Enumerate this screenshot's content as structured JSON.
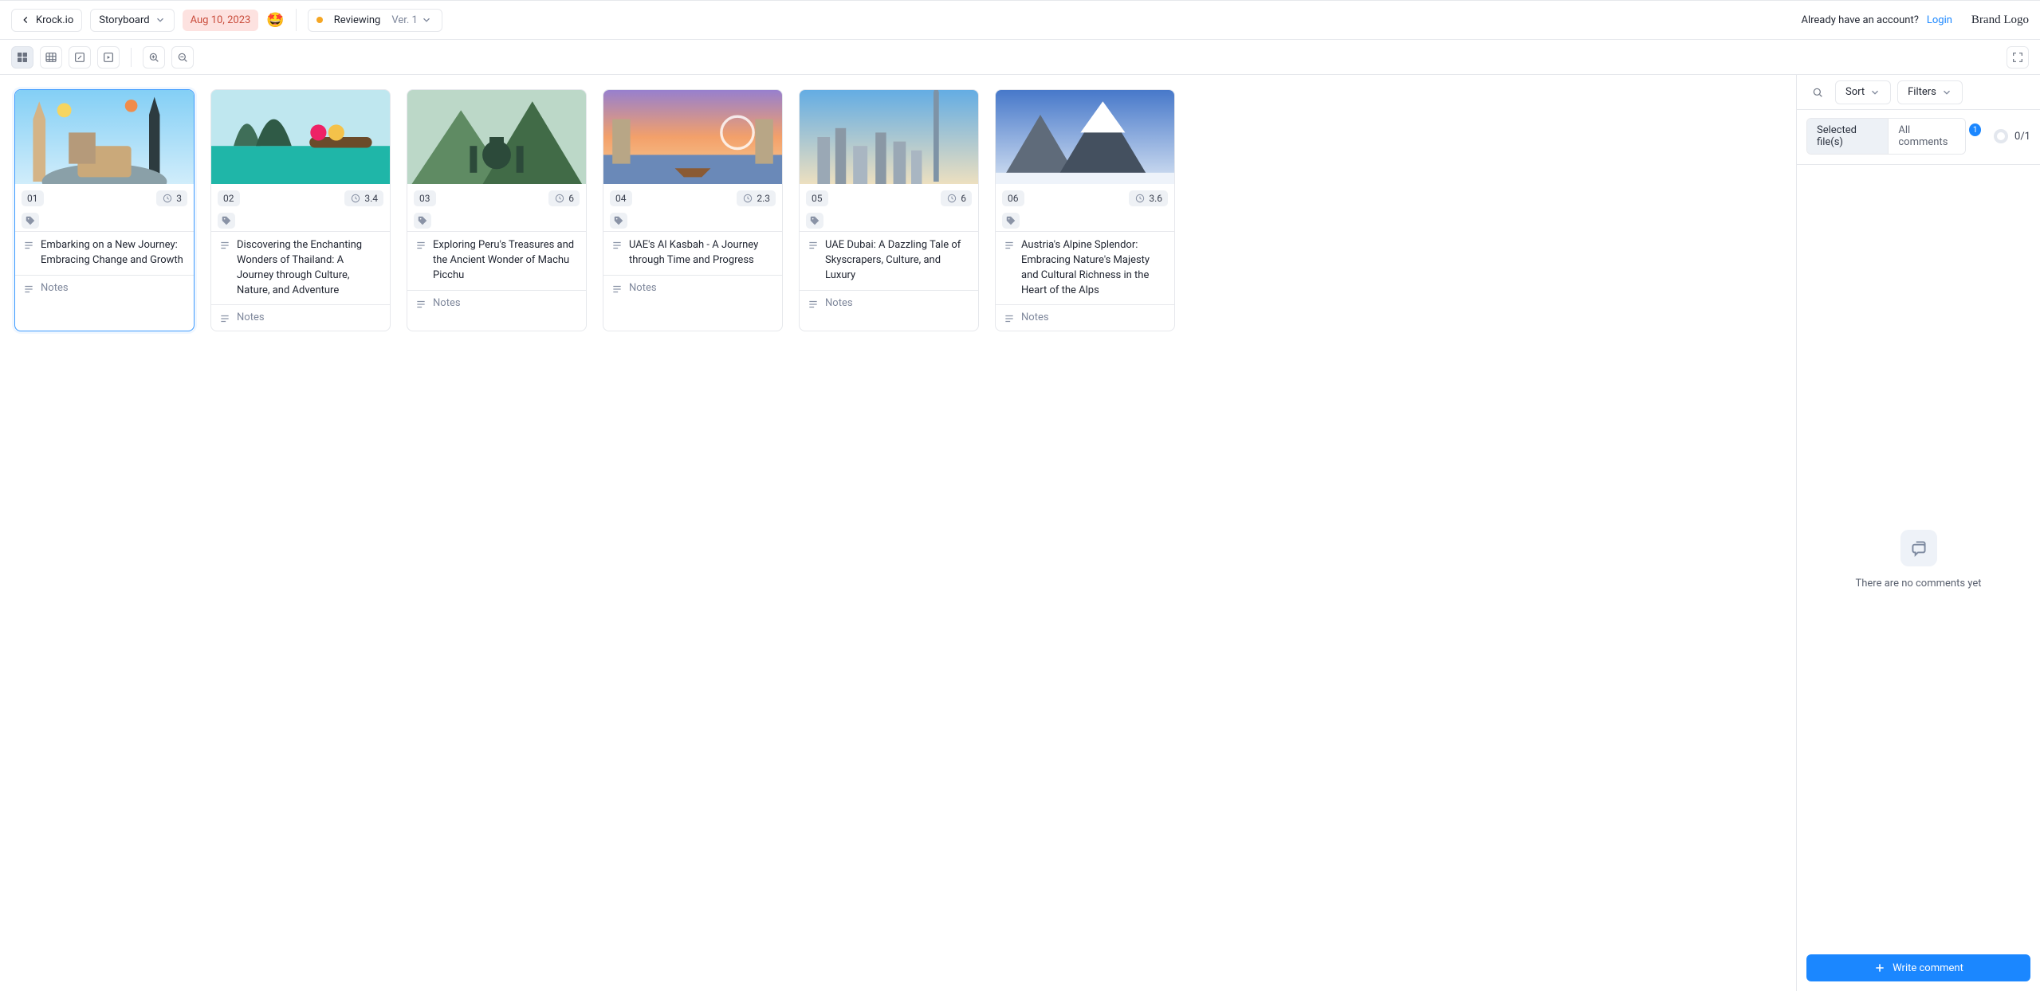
{
  "header": {
    "app": "Krock.io",
    "section": "Storyboard",
    "date": "Aug 10, 2023",
    "status": "Reviewing",
    "version": "Ver. 1",
    "account_prompt": "Already have an account?",
    "login": "Login",
    "brand": "Brand Logo"
  },
  "toolbar": {
    "sort": "Sort",
    "filters": "Filters"
  },
  "side": {
    "tab_selected": "Selected file(s)",
    "tab_all": "All comments",
    "all_badge": "1",
    "progress": "0/1",
    "empty": "There are no comments yet",
    "write": "Write comment"
  },
  "notes_placeholder": "Notes",
  "cards": [
    {
      "num": "01",
      "dur": "3",
      "desc": "Embarking on a New Journey: Embracing Change and Growth",
      "selected": true,
      "img": "landmarks"
    },
    {
      "num": "02",
      "dur": "3.4",
      "desc": "Discovering the Enchanting Wonders of Thailand: A Journey through Culture, Nature, and Adventure",
      "selected": false,
      "img": "thailand"
    },
    {
      "num": "03",
      "dur": "6",
      "desc": "Exploring Peru's Treasures and the Ancient Wonder of Machu Picchu",
      "selected": false,
      "img": "peru"
    },
    {
      "num": "04",
      "dur": "2.3",
      "desc": "UAE's Al Kasbah - A Journey through Time and Progress",
      "selected": false,
      "img": "sharjah"
    },
    {
      "num": "05",
      "dur": "6",
      "desc": "UAE Dubai: A Dazzling Tale of Skyscrapers, Culture, and Luxury",
      "selected": false,
      "img": "dubai"
    },
    {
      "num": "06",
      "dur": "3.6",
      "desc": "Austria's Alpine Splendor: Embracing Nature's Majesty and Cultural Richness in the Heart of the Alps",
      "selected": false,
      "img": "alps"
    }
  ]
}
